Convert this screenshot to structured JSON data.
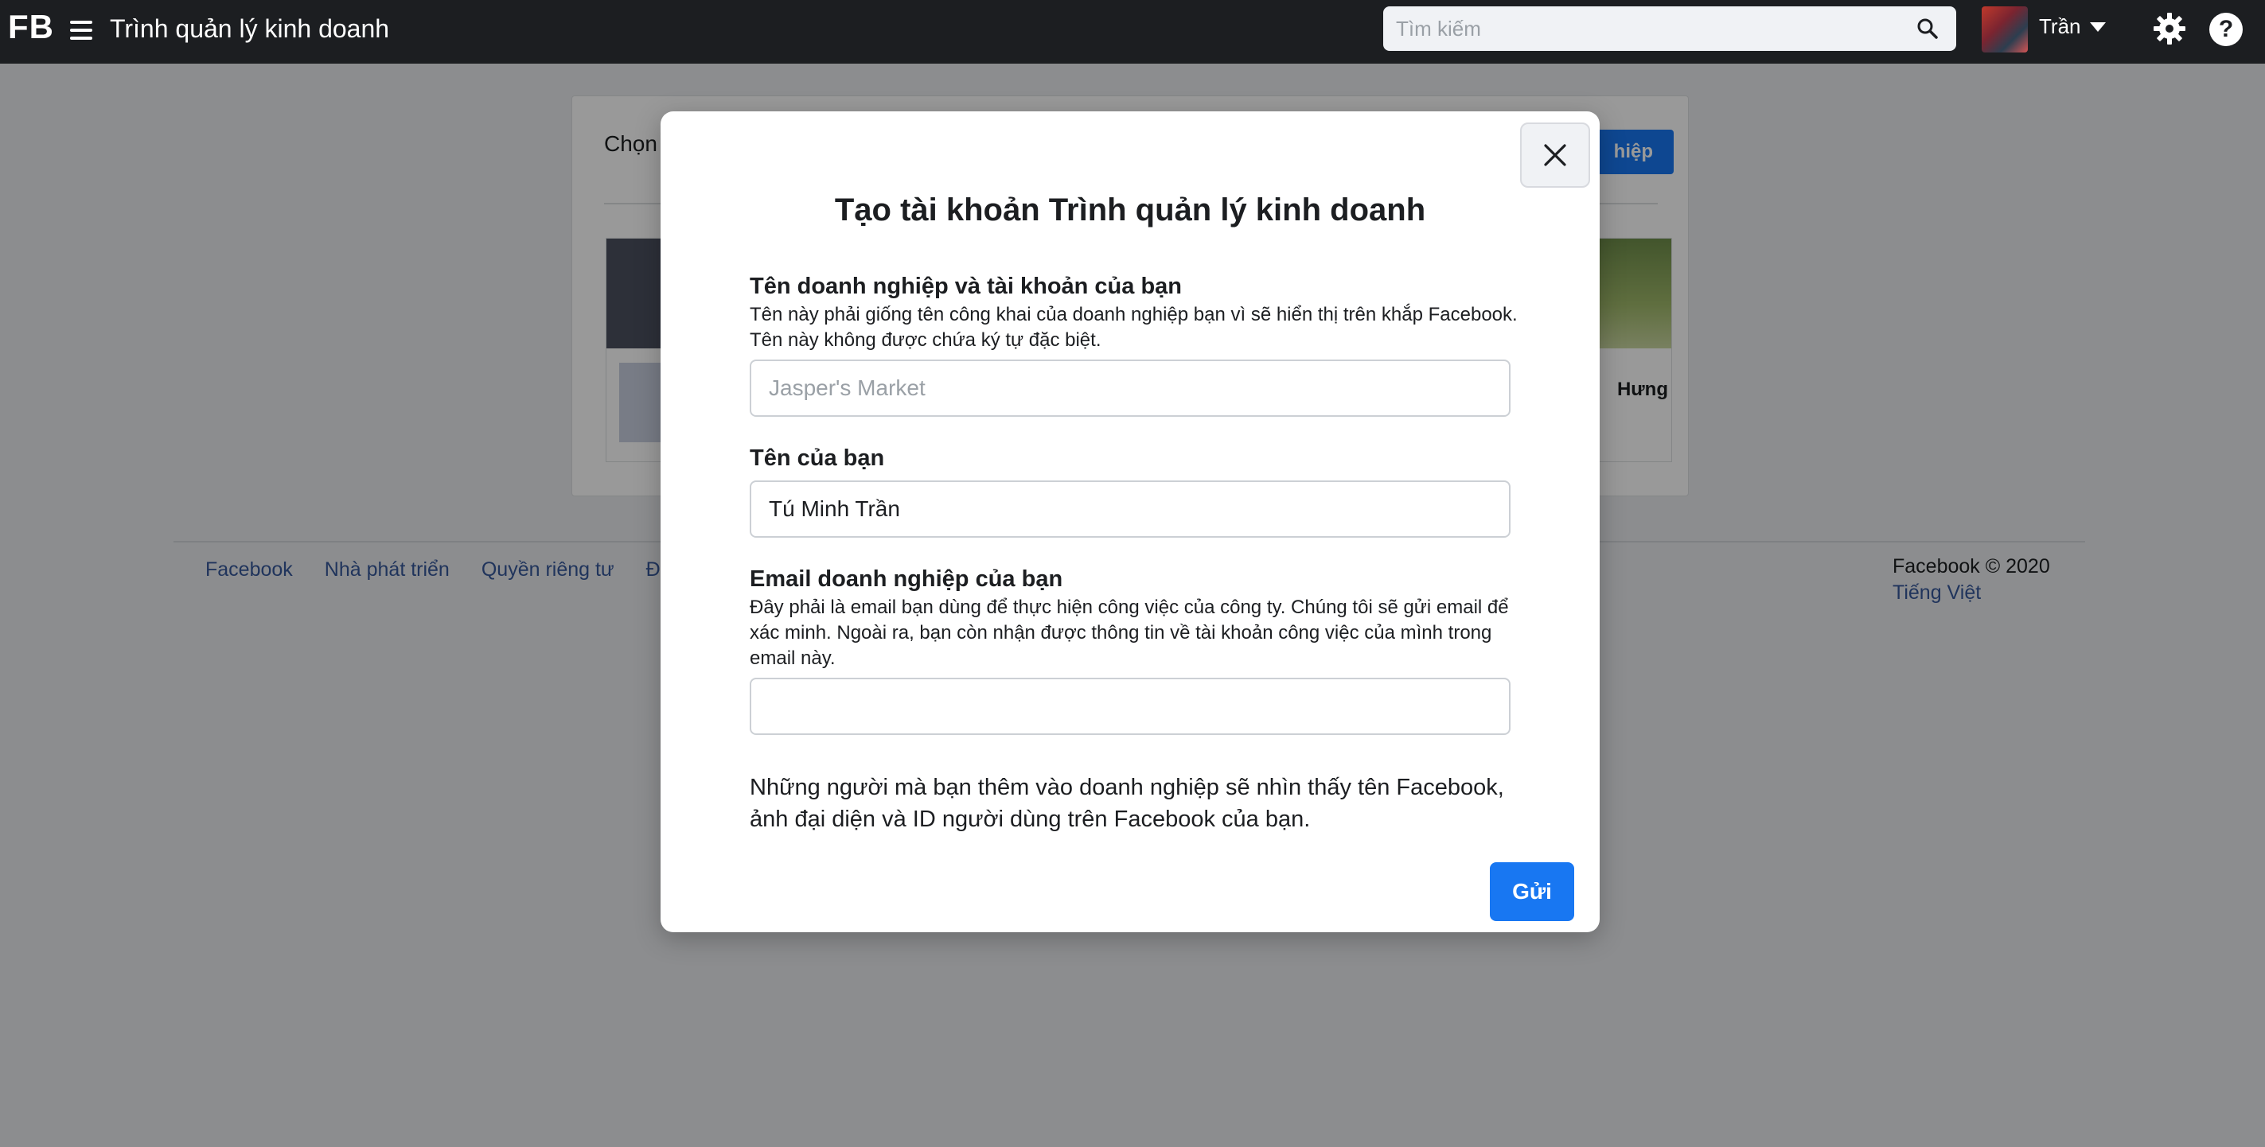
{
  "topbar": {
    "logo": "FB",
    "title": "Trình quản lý kinh doanh",
    "search_placeholder": "Tìm kiếm",
    "user_name": "Trần"
  },
  "background": {
    "card_title": "Chọn",
    "primary_button_label": "hiệp",
    "tile_right_label": "Hưng",
    "footer_links": [
      "Facebook",
      "Nhà phát triển",
      "Quyền riêng tư",
      "Điề"
    ],
    "footer_copyright": "Facebook © 2020",
    "footer_language": "Tiếng Việt"
  },
  "modal": {
    "title": "Tạo tài khoản Trình quản lý kinh doanh",
    "business_name": {
      "label": "Tên doanh nghiệp và tài khoản của bạn",
      "help": "Tên này phải giống tên công khai của doanh nghiệp bạn vì sẽ hiển thị trên khắp Facebook. Tên này không được chứa ký tự đặc biệt.",
      "value": "",
      "placeholder": "Jasper's Market"
    },
    "your_name": {
      "label": "Tên của bạn",
      "value": "Tú Minh Trần"
    },
    "business_email": {
      "label": "Email doanh nghiệp của bạn",
      "help": "Đây phải là email bạn dùng để thực hiện công việc của công ty. Chúng tôi sẽ gửi email để xác minh. Ngoài ra, bạn còn nhận được thông tin về tài khoản công việc của mình trong email này.",
      "value": "",
      "placeholder": ""
    },
    "notice": "Những người mà bạn thêm vào doanh nghiệp sẽ nhìn thấy tên Facebook, ảnh đại diện và ID người dùng trên Facebook của bạn.",
    "submit_label": "Gửi"
  },
  "colors": {
    "topbar": "#1c1e21",
    "accent": "#1877f2",
    "link": "#365899"
  }
}
